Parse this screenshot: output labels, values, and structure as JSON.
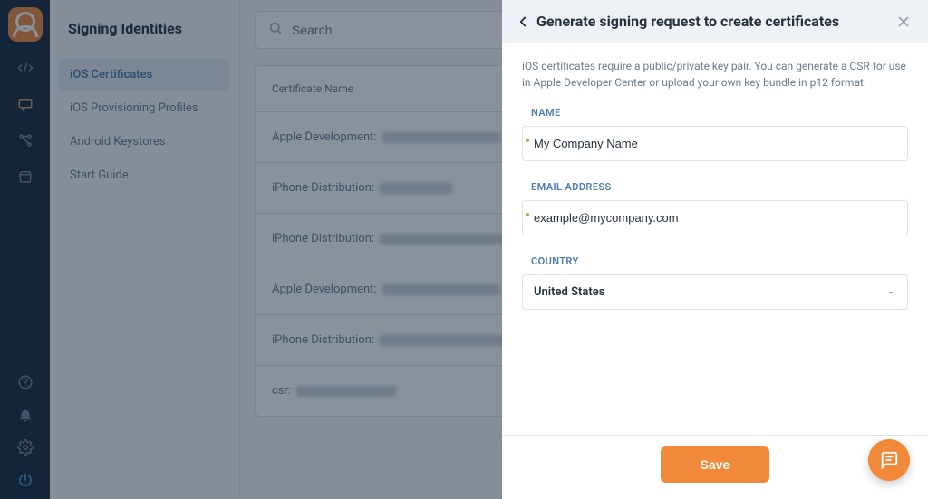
{
  "subnav": {
    "title": "Signing Identities",
    "items": [
      {
        "label": "iOS Certificates",
        "active": true
      },
      {
        "label": "iOS Provisioning Profiles",
        "active": false
      },
      {
        "label": "Android Keystores",
        "active": false
      },
      {
        "label": "Start Guide",
        "active": false
      }
    ]
  },
  "search": {
    "placeholder": "Search"
  },
  "table": {
    "header": "Certificate Name",
    "rows": [
      {
        "label": "Apple Development:",
        "redact_width": 130
      },
      {
        "label": "iPhone Distribution:",
        "redact_width": 80
      },
      {
        "label": "iPhone Distribution:",
        "redact_width": 160
      },
      {
        "label": "Apple Development:",
        "redact_width": 130
      },
      {
        "label": "iPhone Distribution:",
        "redact_width": 160
      },
      {
        "label": "csr:",
        "redact_width": 110
      }
    ]
  },
  "drawer": {
    "title": "Generate signing request to create certificates",
    "description": "iOS certificates require a public/private key pair. You can generate a CSR for use in Apple Developer Center or upload your own key bundle in p12 format.",
    "name_label": "NAME",
    "name_value": "My Company Name",
    "email_label": "EMAIL ADDRESS",
    "email_value": "example@mycompany.com",
    "country_label": "COUNTRY",
    "country_value": "United States",
    "save_label": "Save"
  }
}
